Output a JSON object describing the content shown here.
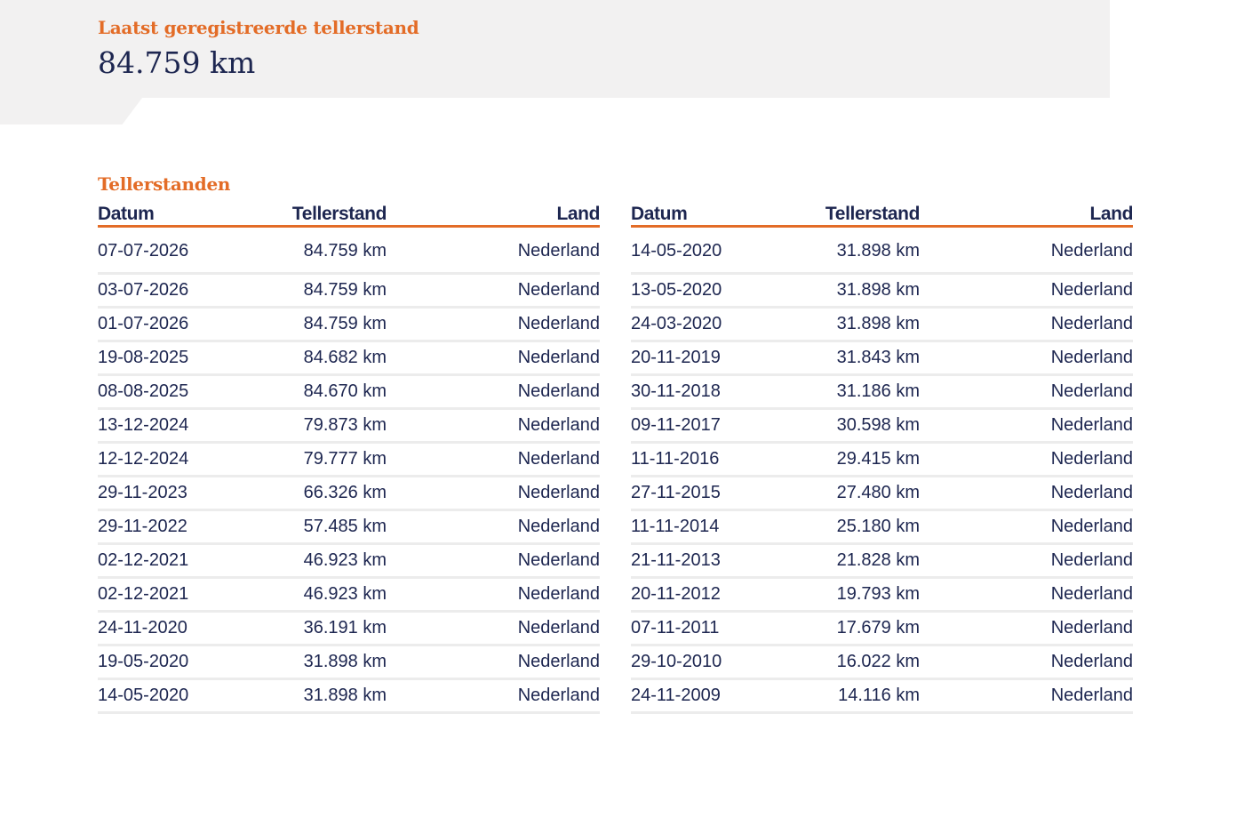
{
  "last_reading": {
    "label": "Laatst geregistreerde tellerstand",
    "value": "84.759 km"
  },
  "readings": {
    "title": "Tellerstanden",
    "columns": {
      "date": "Datum",
      "odometer": "Tellerstand",
      "country": "Land"
    },
    "left_rows": [
      {
        "date": "07-07-2026",
        "odometer": "84.759 km",
        "country": "Nederland"
      },
      {
        "date": "03-07-2026",
        "odometer": "84.759 km",
        "country": "Nederland"
      },
      {
        "date": "01-07-2026",
        "odometer": "84.759 km",
        "country": "Nederland"
      },
      {
        "date": "19-08-2025",
        "odometer": "84.682 km",
        "country": "Nederland"
      },
      {
        "date": "08-08-2025",
        "odometer": "84.670 km",
        "country": "Nederland"
      },
      {
        "date": "13-12-2024",
        "odometer": "79.873 km",
        "country": "Nederland"
      },
      {
        "date": "12-12-2024",
        "odometer": "79.777 km",
        "country": "Nederland"
      },
      {
        "date": "29-11-2023",
        "odometer": "66.326 km",
        "country": "Nederland"
      },
      {
        "date": "29-11-2022",
        "odometer": "57.485 km",
        "country": "Nederland"
      },
      {
        "date": "02-12-2021",
        "odometer": "46.923 km",
        "country": "Nederland"
      },
      {
        "date": "02-12-2021",
        "odometer": "46.923 km",
        "country": "Nederland"
      },
      {
        "date": "24-11-2020",
        "odometer": "36.191 km",
        "country": "Nederland"
      },
      {
        "date": "19-05-2020",
        "odometer": "31.898 km",
        "country": "Nederland"
      },
      {
        "date": "14-05-2020",
        "odometer": "31.898 km",
        "country": "Nederland"
      }
    ],
    "right_rows": [
      {
        "date": "14-05-2020",
        "odometer": "31.898 km",
        "country": "Nederland"
      },
      {
        "date": "13-05-2020",
        "odometer": "31.898 km",
        "country": "Nederland"
      },
      {
        "date": "24-03-2020",
        "odometer": "31.898 km",
        "country": "Nederland"
      },
      {
        "date": "20-11-2019",
        "odometer": "31.843 km",
        "country": "Nederland"
      },
      {
        "date": "30-11-2018",
        "odometer": "31.186 km",
        "country": "Nederland"
      },
      {
        "date": "09-11-2017",
        "odometer": "30.598 km",
        "country": "Nederland"
      },
      {
        "date": "11-11-2016",
        "odometer": "29.415 km",
        "country": "Nederland"
      },
      {
        "date": "27-11-2015",
        "odometer": "27.480 km",
        "country": "Nederland"
      },
      {
        "date": "11-11-2014",
        "odometer": "25.180 km",
        "country": "Nederland"
      },
      {
        "date": "21-11-2013",
        "odometer": "21.828 km",
        "country": "Nederland"
      },
      {
        "date": "20-11-2012",
        "odometer": "19.793 km",
        "country": "Nederland"
      },
      {
        "date": "07-11-2011",
        "odometer": "17.679 km",
        "country": "Nederland"
      },
      {
        "date": "29-10-2010",
        "odometer": "16.022 km",
        "country": "Nederland"
      },
      {
        "date": "24-11-2009",
        "odometer": "14.116 km",
        "country": "Nederland"
      }
    ]
  },
  "colors": {
    "accent": "#e36c27",
    "text": "#1d2650",
    "panel": "#f2f1f1",
    "row_divider": "#ececec"
  }
}
